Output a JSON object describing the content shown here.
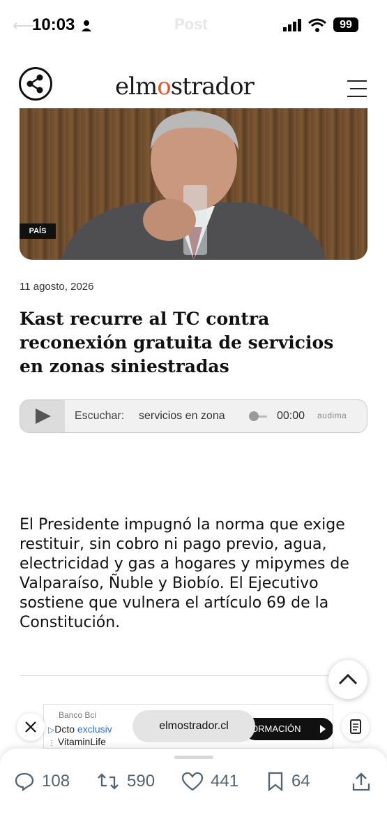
{
  "status_bar": {
    "time": "10:03",
    "battery": "99",
    "faded_title": "Post"
  },
  "site": {
    "logo_part1": "elm",
    "logo_dot": "o",
    "logo_part2": "strador"
  },
  "hero": {
    "section_tag": "PAÍS"
  },
  "article": {
    "date": "11 agosto, 2026",
    "headline": "Kast recurre al TC contra reconexión gratuita de servicios en zonas siniestradas",
    "lead": "El Presidente impugnó la norma que exige restituir, sin cobro ni pago previo, agua, electricidad y gas a hogares y mipymes de Valparaíso, Ñuble y Biobío. El Ejecutivo sostiene que vulnera el artículo 69 de la Constitución."
  },
  "player": {
    "label": "Escuchar:",
    "title": "servicios en zona",
    "time": "00:00",
    "brand": "audima"
  },
  "ad": {
    "sponsor": "Banco Bci",
    "line1_prefix": "Dcto ",
    "line1_highlight": "exclusiv",
    "line2": "VitaminLife",
    "cta": "ORMACIÓN"
  },
  "browser": {
    "url": "elmostrador.cl"
  },
  "actions": {
    "replies": "108",
    "reposts": "590",
    "likes": "441",
    "bookmarks": "64"
  },
  "colors": {
    "logo_accent": "#e2572b",
    "ad_highlight": "#2f6fd6"
  }
}
